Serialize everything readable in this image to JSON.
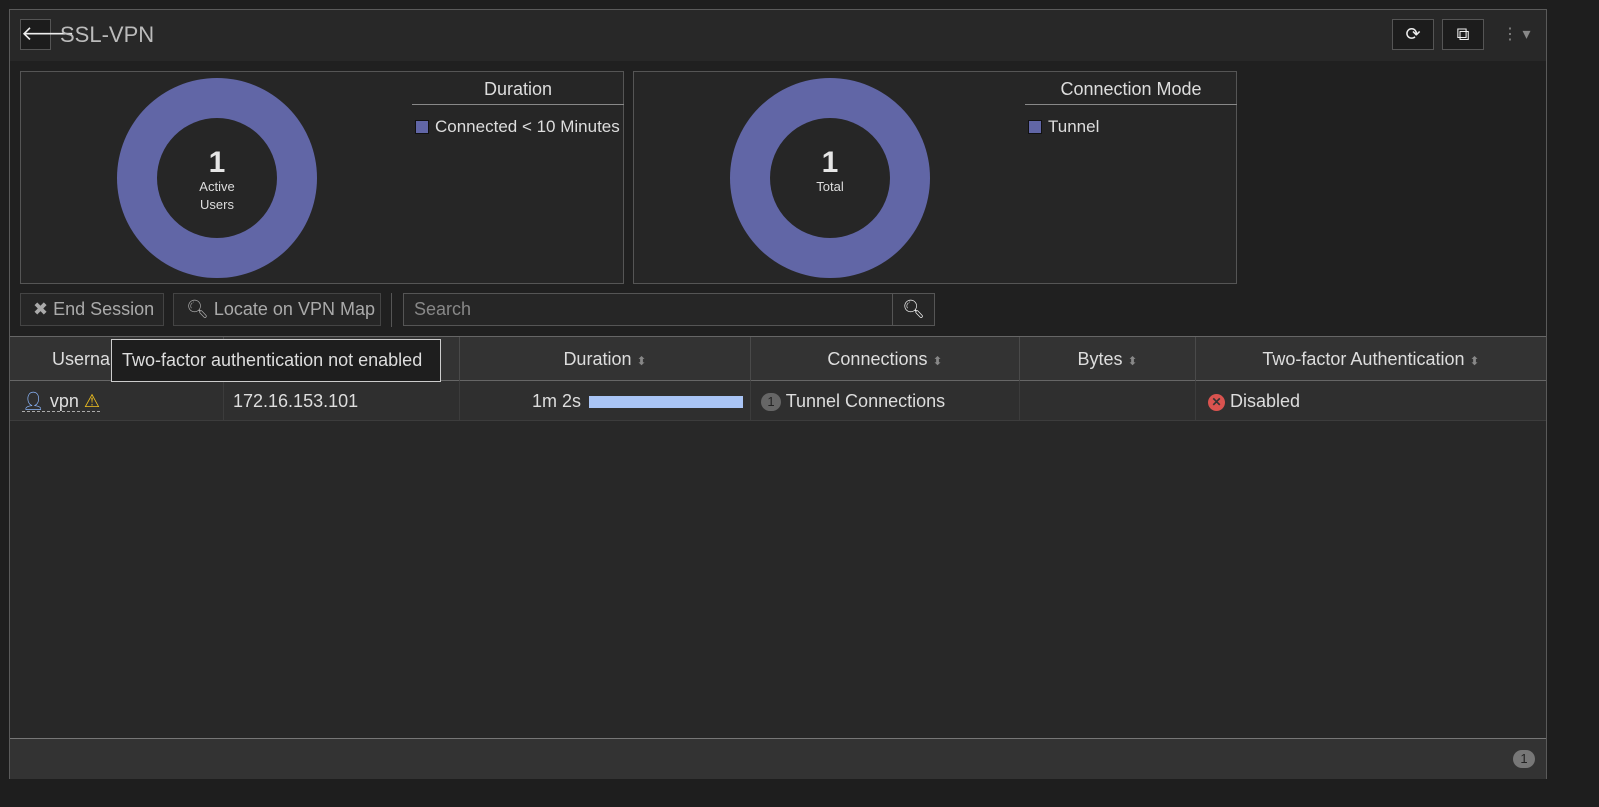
{
  "header": {
    "title": "SSL-VPN",
    "back_icon": "arrow-left-icon",
    "refresh_icon": "refresh-icon",
    "popout_icon": "external-link-icon",
    "menu_icon": "kebab-menu-icon"
  },
  "charts": [
    {
      "center_value": "1",
      "center_label_1": "Active",
      "center_label_2": "Users",
      "legend_title": "Duration",
      "legend_items": [
        {
          "label": "Connected < 10 Minutes",
          "color": "#6166a6",
          "value": 1
        }
      ]
    },
    {
      "center_value": "1",
      "center_label_1": "Total",
      "legend_title": "Connection Mode",
      "legend_items": [
        {
          "label": "Tunnel",
          "color": "#6166a6",
          "value": 1
        }
      ]
    }
  ],
  "toolbar": {
    "end_session": "End Session",
    "locate": "Locate on VPN Map",
    "search_placeholder": "Search"
  },
  "table": {
    "columns": [
      "Userna",
      "",
      "Duration",
      "Connections",
      "Bytes",
      "Two-factor Authentication"
    ],
    "rows": [
      {
        "username": "vpn",
        "ip": "172.16.153.101",
        "duration": "1m 2s",
        "duration_fraction": 1.0,
        "connections_count": "1",
        "connections": "Tunnel Connections",
        "bytes": "",
        "twofa": "Disabled"
      }
    ]
  },
  "tooltip": "Two-factor authentication not enabled",
  "footer": {
    "count": "1"
  },
  "colors": {
    "donut": "#6166a6",
    "bar": "#a9c4f5",
    "error": "#d9534f",
    "warning": "#f0c020"
  }
}
